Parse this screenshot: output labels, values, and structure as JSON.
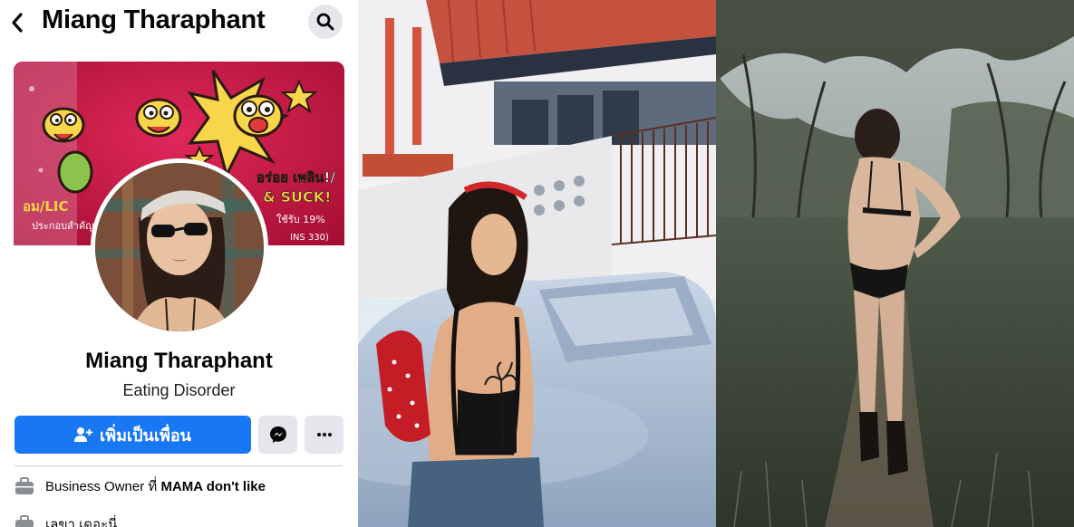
{
  "header": {
    "title": "Miang Tharaphant",
    "back_icon": "chevron-left-icon",
    "search_icon": "search-icon"
  },
  "cover": {
    "caption_lines": [
      "อร่อย เพลิน!/",
      "& SUCK!",
      "อม/LIC",
      "ประกอบสำคัญ",
      "ใช้รับ 19%",
      "INS 330)"
    ]
  },
  "profile": {
    "name": "Miang Tharaphant",
    "bio": "Eating Disorder"
  },
  "actions": {
    "add_friend_label": "เพิ่มเป็นเพื่อน",
    "add_friend_icon": "add-person-icon",
    "messenger_icon": "messenger-icon",
    "more_icon": "more-horizontal-icon"
  },
  "info": {
    "work_prefix": "Business Owner ที่",
    "work_place": "MAMA don't like",
    "work_icon": "briefcase-icon",
    "second_row_text": "เลขา เดอะนี่"
  },
  "colors": {
    "primary": "#1877f2",
    "button_gray": "#e4e6eb",
    "text": "#050505",
    "cover_red": "#c3123b"
  }
}
